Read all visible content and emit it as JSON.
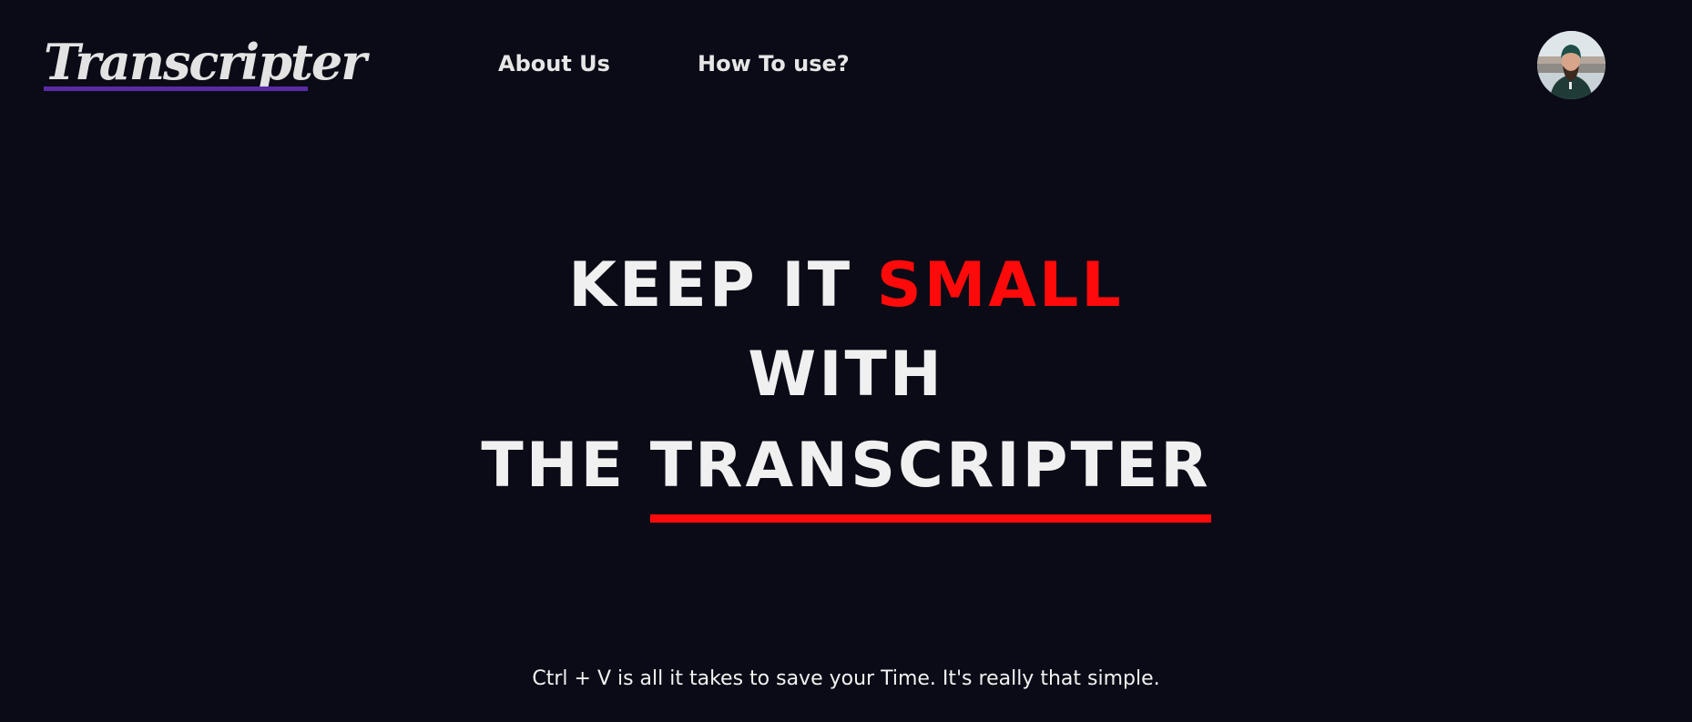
{
  "header": {
    "logo_text": "Transcripter",
    "nav": {
      "about_label": "About Us",
      "howto_label": "How To use?"
    },
    "avatar_alt": "user avatar"
  },
  "hero": {
    "line1_prefix": "KEEP IT",
    "line1_accent": "SMALL",
    "line2": "WITH",
    "line3_prefix": "THE",
    "line3_underlined": "TRANSCRIPTER"
  },
  "tagline": "Ctrl + V is all it takes to save your Time. It's really that simple.",
  "colors": {
    "background": "#0a0b16",
    "accent": "#ff0a0a",
    "logo_underline": "#5a2aa6",
    "text": "#f0f0f0"
  }
}
